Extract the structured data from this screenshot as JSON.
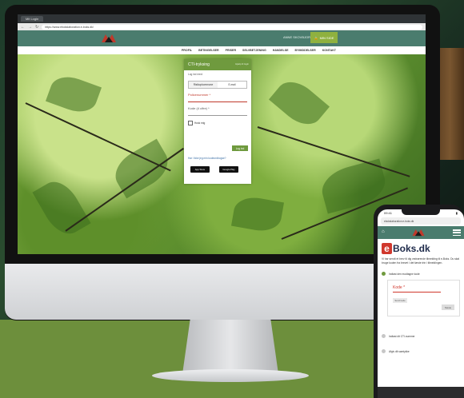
{
  "desktop": {
    "browser_tab": "Mit Login",
    "url": "https://www.ebokslaboration.e-boks.dk/",
    "header": {
      "phone": "ANNE SKOVBJOR",
      "login_button": "MIN SIDE"
    },
    "nav": [
      "PROFIL",
      "BETINGELSER",
      "PRISER",
      "SELVBETJENING",
      "HANDELSE",
      "BYMIDDELSER",
      "KONTAKT"
    ],
    "login_panel": {
      "title": "CTI-tryksing",
      "help_link": "Hjælp til login",
      "subtitle": "Log ind med:",
      "method_left": "Risikopkommune",
      "method_right": "E-mail",
      "field_policy": "Policenummer *",
      "field_code": "Kode (4 cifre) *",
      "remember_label": "Husk mig",
      "submit": "Log ind",
      "forgot_link": "Har I ikke jeg min kodeordbogse?",
      "app_store": "App Store",
      "google_play": "Google Play"
    }
  },
  "phone": {
    "status_time": "09:41",
    "url": "ebokslaboration.e-boks.dk",
    "header_menu": "MENU",
    "brand_e": "e",
    "brand_rest": "Boks.dk",
    "intro": "Vi har sendt et brev til dig vedrørende tilmelding til e-Boks. Du skal bruge koden fra brevet i det første trin i tilmeldingen.",
    "step1": "Indtast den modtagne kode",
    "code_label": "Kode *",
    "resend": "Send kode",
    "next": "Næste",
    "step2": "Indtast dit CTI-nummer",
    "step3": "Afgiv dit samtykke"
  },
  "colors": {
    "site_green": "#4a7c6e",
    "accent_green": "#6f9a3e",
    "eboks_red": "#d0382d",
    "eboks_navy": "#1e2a4a"
  }
}
